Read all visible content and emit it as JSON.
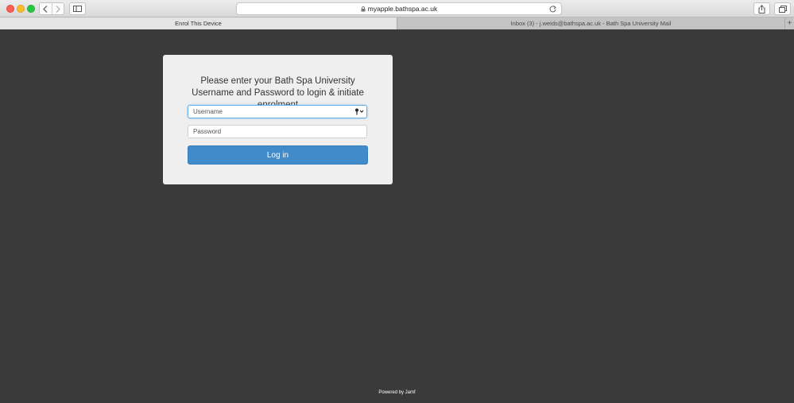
{
  "browser": {
    "url": "myapple.bathspa.ac.uk",
    "tabs": [
      {
        "label": "Enrol This Device",
        "active": true
      },
      {
        "label": "Inbox (3) - j.weids@bathspa.ac.uk - Bath Spa University Mail",
        "active": false
      }
    ],
    "new_tab_label": "+",
    "icons": [
      "back-icon",
      "forward-icon",
      "sidebar-icon",
      "lock-icon",
      "reload-icon",
      "share-icon",
      "tabs-overview-icon"
    ]
  },
  "login": {
    "heading": "Please enter your Bath Spa University Username and Password to login & initiate enrolment",
    "username_placeholder": "Username",
    "password_placeholder": "Password",
    "button_label": "Log in"
  },
  "footer": {
    "text": "Powered by Jamf"
  },
  "colors": {
    "page_background": "#3a3a3a",
    "card_background": "#efefef",
    "button_primary": "#428bca"
  }
}
